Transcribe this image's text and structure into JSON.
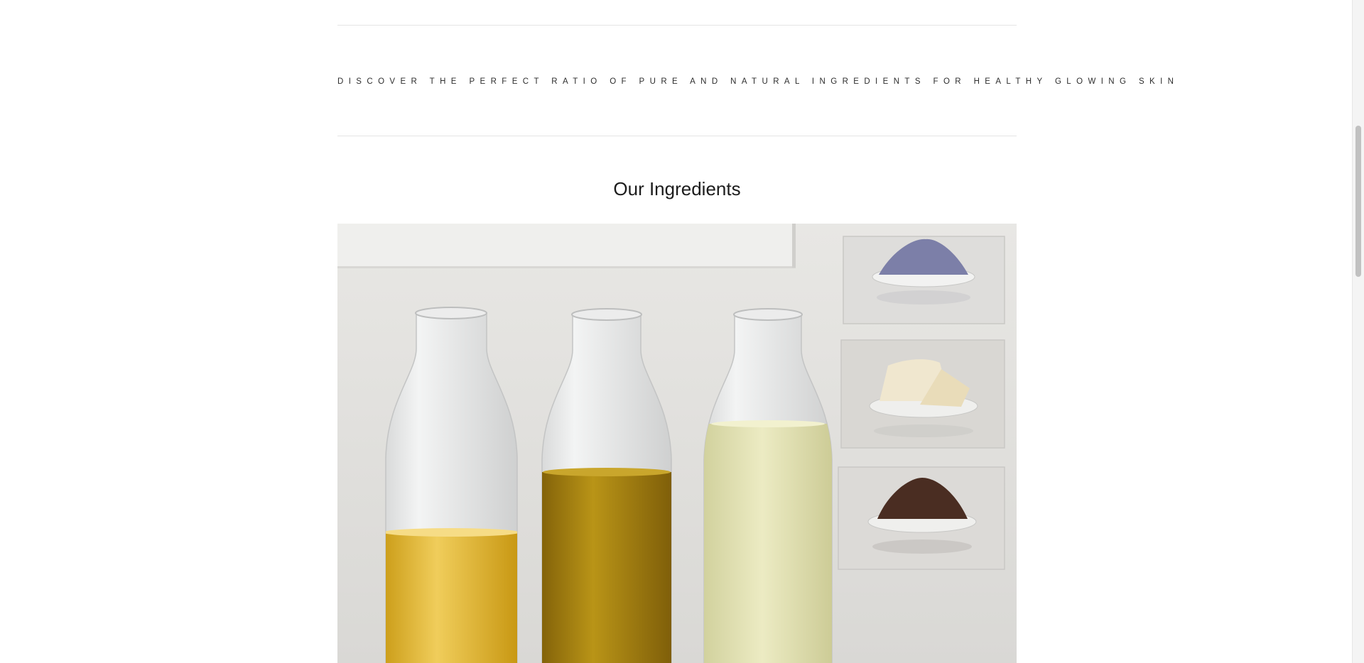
{
  "banner": {
    "tagline": "DISCOVER THE PERFECT RATIO OF PURE AND NATURAL INGREDIENTS FOR HEALTHY GLOWING SKIN"
  },
  "ingredients": {
    "title": "Our Ingredients"
  },
  "colors": {
    "background": "#ffffff",
    "rule": "#e4e4e4",
    "text": "#2d2d2d"
  }
}
